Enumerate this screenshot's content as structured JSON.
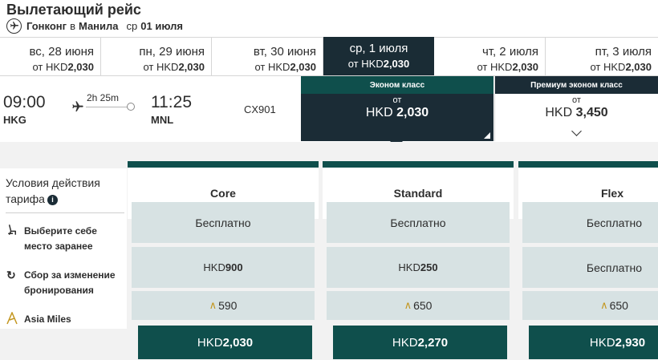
{
  "header": {
    "title": "Вылетающий рейс",
    "origin": "Гонконг",
    "connector": "в",
    "destination": "Манила",
    "day": "ср",
    "date": "01 июля"
  },
  "dates": [
    {
      "label": "вс, 28 июня",
      "from": "от",
      "currency": "HKD",
      "amount": "2,030",
      "active": false
    },
    {
      "label": "пн, 29 июня",
      "from": "от",
      "currency": "HKD",
      "amount": "2,030",
      "active": false
    },
    {
      "label": "вт, 30 июня",
      "from": "от",
      "currency": "HKD",
      "amount": "2,030",
      "active": false
    },
    {
      "label": "ср, 1 июля",
      "from": "от",
      "currency": "HKD",
      "amount": "2,030",
      "active": true
    },
    {
      "label": "чт, 2 июля",
      "from": "от",
      "currency": "HKD",
      "amount": "2,030",
      "active": false
    },
    {
      "label": "пт, 3 июля",
      "from": "от",
      "currency": "HKD",
      "amount": "2,030",
      "active": false
    }
  ],
  "flight": {
    "dep_time": "09:00",
    "dep_code": "HKG",
    "duration": "2h 25m",
    "arr_time": "11:25",
    "arr_code": "MNL",
    "flight_no": "CX901"
  },
  "cabins": {
    "economy": {
      "name": "Эконом класс",
      "from": "от",
      "currency": "HKD",
      "amount": "2,030"
    },
    "premium": {
      "name": "Премиум эконом класс",
      "from": "от",
      "currency": "HKD",
      "amount": "3,450"
    }
  },
  "conditions": {
    "title": "Условия действия тарифа",
    "info_icon": "i",
    "items": [
      {
        "icon": "seat-icon",
        "line1": "Выберите себе",
        "line2": "место заранее"
      },
      {
        "icon": "refresh-icon",
        "line1": "Сбор за изменение",
        "line2": "бронирования"
      },
      {
        "icon": "asia-miles-icon",
        "line1": "Asia Miles",
        "line2": ""
      }
    ]
  },
  "fares": [
    {
      "name": "Core",
      "seat": "Бесплатно",
      "change_currency": "HKD",
      "change_amount": "900",
      "miles": "590",
      "price_currency": "HKD",
      "price_amount": "2,030"
    },
    {
      "name": "Standard",
      "seat": "Бесплатно",
      "change_currency": "HKD",
      "change_amount": "250",
      "miles": "650",
      "price_currency": "HKD",
      "price_amount": "2,270"
    },
    {
      "name": "Flex",
      "seat": "Бесплатно",
      "change_currency": "HKD",
      "change_amount": "",
      "change_text": "Бесплатно",
      "miles": "650",
      "price_currency": "HKD",
      "price_amount": "2,930"
    }
  ],
  "colors": {
    "teal": "#0f4f4c",
    "navy": "#1b2c36",
    "cell": "#d7e2e3",
    "miles_gold": "#c3961f"
  }
}
